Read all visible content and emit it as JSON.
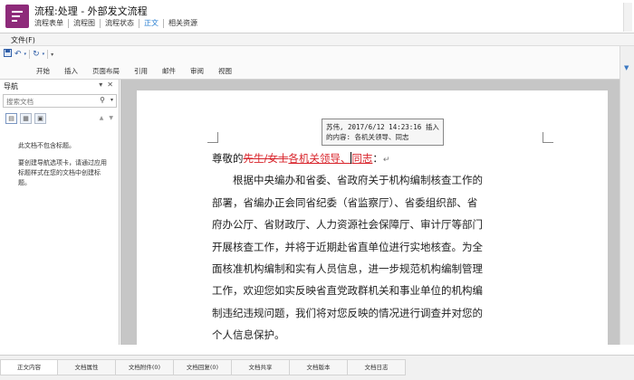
{
  "header": {
    "title": "流程:处理 - 外部发文流程",
    "tabs": [
      {
        "label": "流程表单"
      },
      {
        "label": "流程图"
      },
      {
        "label": "流程状态"
      },
      {
        "label": "正文",
        "active": true
      },
      {
        "label": "相关资源"
      }
    ]
  },
  "file_menu": "文件(F)",
  "ribbon": {
    "tabs": [
      "开始",
      "插入",
      "页面布局",
      "引用",
      "邮件",
      "审阅",
      "视图"
    ]
  },
  "nav": {
    "title": "导航",
    "search_placeholder": "搜索文档",
    "message_1": "此文档不包含标题。",
    "message_2": "要创建导航选项卡，请通过应用标题样式在您的文档中创建标题。"
  },
  "revision": {
    "line1": "苏伟, 2017/6/12 14:23:16 插入",
    "line2": "的内容: 各机关领导、同志"
  },
  "document": {
    "salutation_prefix": "尊敬的",
    "deleted_text": "先生/女士",
    "inserted_text_1": "各机关领导、",
    "inserted_text_2": "同志",
    "salutation_suffix": "：",
    "paragraph_lines": [
      "根据中央编办和省委、省政府关于机构编制核查工作的",
      "部署，省编办正会同省纪委（省监察厅）、省委组织部、省",
      "府办公厅、省财政厅、人力资源社会保障厅、审计厅等部门",
      "开展核查工作，并将于近期赴省直单位进行实地核查。为全",
      "面核准机构编制和实有人员信息，进一步规范机构编制管理",
      "工作，欢迎您如实反映省直党政群机关和事业单位的机构编",
      "制违纪违规问题，我们将对您反映的情况进行调查并对您的",
      "个人信息保护。"
    ]
  },
  "bottom_tabs": [
    {
      "label": "正文内容",
      "active": true
    },
    {
      "label": "文档属性"
    },
    {
      "label": "文档附件(0)"
    },
    {
      "label": "文档回复(0)"
    },
    {
      "label": "文档共享"
    },
    {
      "label": "文档版本"
    },
    {
      "label": "文档日志"
    }
  ],
  "colors": {
    "accent": "#2a7fd1",
    "logo": "#8e2b7a",
    "revision": "#d8232a"
  },
  "icons": [
    "flow-logo-icon",
    "save-icon",
    "undo-icon",
    "redo-icon",
    "search-icon",
    "close-icon"
  ]
}
